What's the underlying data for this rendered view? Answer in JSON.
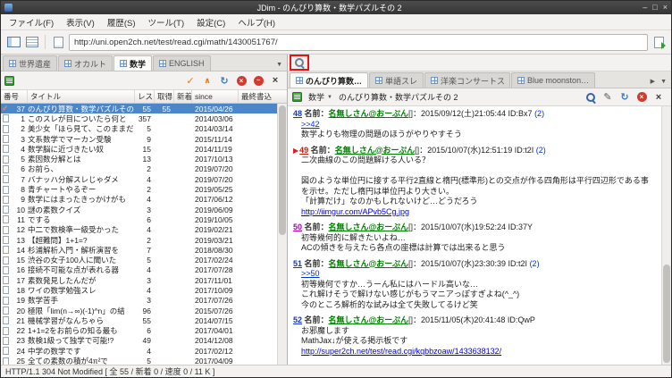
{
  "window": {
    "title": "JDim - のんびり算数・数学パズルその 2"
  },
  "menubar": {
    "items": [
      "ファイル(F)",
      "表示(V)",
      "履歴(S)",
      "ツール(T)",
      "設定(C)",
      "ヘルプ(H)"
    ]
  },
  "toolbar": {
    "url": "http://uni.open2ch.net/test/read.cgi/math/1430051767/"
  },
  "board_panel": {
    "tabs": [
      {
        "label": "世界遺産",
        "active": false
      },
      {
        "label": "オカルト",
        "active": false
      },
      {
        "label": "数学",
        "active": true
      },
      {
        "label": "ENGLISH",
        "active": false
      }
    ],
    "toolbar_icons": [
      "update-check",
      "update",
      "reload",
      "stop",
      "delete",
      "close"
    ],
    "columns": [
      "番号",
      "タイトル",
      "レス",
      "取得",
      "新着",
      "since",
      "最終書込"
    ],
    "rows": [
      {
        "no": "37",
        "title": "のんびり算数・数学パズルその 2",
        "res": "55",
        "got": "55",
        "new": "",
        "since": "2015/04/26",
        "last": "",
        "selected": true
      },
      {
        "no": "1",
        "title": "このスレが目についたら何と",
        "res": "357",
        "got": "",
        "new": "",
        "since": "2014/03/06",
        "last": "",
        "selected": false
      },
      {
        "no": "2",
        "title": "美少女「ほら見て、このままだ",
        "res": "5",
        "got": "",
        "new": "",
        "since": "2014/03/14",
        "last": "",
        "selected": false
      },
      {
        "no": "3",
        "title": "文系数学でマーカン受験",
        "res": "9",
        "got": "",
        "new": "",
        "since": "2015/11/14",
        "last": "",
        "selected": false
      },
      {
        "no": "4",
        "title": "数学脳に近づきたい奴",
        "res": "15",
        "got": "",
        "new": "",
        "since": "2014/11/19",
        "last": "",
        "selected": false
      },
      {
        "no": "5",
        "title": "素因数分解とは",
        "res": "13",
        "got": "",
        "new": "",
        "since": "2017/10/13",
        "last": "",
        "selected": false
      },
      {
        "no": "6",
        "title": "お前ら、",
        "res": "2",
        "got": "",
        "new": "",
        "since": "2019/07/20",
        "last": "",
        "selected": false
      },
      {
        "no": "7",
        "title": "バナッハ分解スレじゃダメ",
        "res": "4",
        "got": "",
        "new": "",
        "since": "2019/07/20",
        "last": "",
        "selected": false
      },
      {
        "no": "8",
        "title": "青チャートやるぞー",
        "res": "2",
        "got": "",
        "new": "",
        "since": "2019/05/25",
        "last": "",
        "selected": false
      },
      {
        "no": "9",
        "title": "数学にはまったきっかけがも",
        "res": "4",
        "got": "",
        "new": "",
        "since": "2017/06/12",
        "last": "",
        "selected": false
      },
      {
        "no": "10",
        "title": "謎の素数クイズ",
        "res": "3",
        "got": "",
        "new": "",
        "since": "2019/06/09",
        "last": "",
        "selected": false
      },
      {
        "no": "11",
        "title": "でする",
        "res": "6",
        "got": "",
        "new": "",
        "since": "2019/10/05",
        "last": "",
        "selected": false
      },
      {
        "no": "12",
        "title": "中二で数検準一級受かった",
        "res": "4",
        "got": "",
        "new": "",
        "since": "2019/02/21",
        "last": "",
        "selected": false
      },
      {
        "no": "13",
        "title": "【超難問】1+1=?",
        "res": "2",
        "got": "",
        "new": "",
        "since": "2019/03/21",
        "last": "",
        "selected": false
      },
      {
        "no": "14",
        "title": "杉浦解析入門・解析演習を",
        "res": "7",
        "got": "",
        "new": "",
        "since": "2018/08/30",
        "last": "",
        "selected": false
      },
      {
        "no": "15",
        "title": "渋谷の女子100人に聞いた",
        "res": "5",
        "got": "",
        "new": "",
        "since": "2017/02/24",
        "last": "",
        "selected": false
      },
      {
        "no": "16",
        "title": "接続不可能な点が表れる器",
        "res": "4",
        "got": "",
        "new": "",
        "since": "2017/07/28",
        "last": "",
        "selected": false
      },
      {
        "no": "17",
        "title": "素数発見したんだが",
        "res": "3",
        "got": "",
        "new": "",
        "since": "2017/11/01",
        "last": "",
        "selected": false
      },
      {
        "no": "18",
        "title": "ワイの数学勉強スレ",
        "res": "4",
        "got": "",
        "new": "",
        "since": "2017/10/09",
        "last": "",
        "selected": false
      },
      {
        "no": "19",
        "title": "数学苦手",
        "res": "3",
        "got": "",
        "new": "",
        "since": "2017/07/26",
        "last": "",
        "selected": false
      },
      {
        "no": "20",
        "title": "極限「lim(n→∞)(-1)^n」の結",
        "res": "96",
        "got": "",
        "new": "",
        "since": "2015/07/26",
        "last": "",
        "selected": false
      },
      {
        "no": "21",
        "title": "機械学習がなんちゃら",
        "res": "55",
        "got": "",
        "new": "",
        "since": "2014/07/15",
        "last": "",
        "selected": false
      },
      {
        "no": "22",
        "title": "1+1=2をお前らの知る最も",
        "res": "6",
        "got": "",
        "new": "",
        "since": "2017/04/01",
        "last": "",
        "selected": false
      },
      {
        "no": "23",
        "title": "数検1級って独学で可能!?",
        "res": "49",
        "got": "",
        "new": "",
        "since": "2014/12/08",
        "last": "",
        "selected": false
      },
      {
        "no": "24",
        "title": "中学の数学です",
        "res": "4",
        "got": "",
        "new": "",
        "since": "2017/02/12",
        "last": "",
        "selected": false
      },
      {
        "no": "25",
        "title": "全ての素数の積が4π²で",
        "res": "5",
        "got": "",
        "new": "",
        "since": "2017/04/09",
        "last": "",
        "selected": false
      }
    ]
  },
  "thread_panel": {
    "tabs": [
      {
        "label": "のんびり算数…",
        "active": true
      },
      {
        "label": "単語スレ",
        "active": false
      },
      {
        "label": "洋楽コンサートスレ",
        "active": false
      },
      {
        "label": "Blue moonston…",
        "active": false
      }
    ],
    "board_label": "数学",
    "title": "のんびり算数・数学パズルその 2",
    "toolbar_icons": [
      "search",
      "write",
      "reload",
      "stop",
      "close"
    ],
    "name_label": "名前：",
    "posts": [
      {
        "num": "48",
        "num_color": "#1536c9",
        "marker": "",
        "name": "名無しさん@おーぷん",
        "mail": "[]",
        "date": "：2015/09/12(土)21:05:44",
        "id": "ID:Bx7",
        "count": "(2)",
        "lines": [
          {
            "t": "anchor",
            "s": ">>42"
          },
          {
            "t": "text",
            "s": "数学よりも物理の問題のほうがやりやすそう"
          }
        ]
      },
      {
        "num": "49",
        "num_color": "#c21807",
        "marker": "▶",
        "name": "名無しさん@おーぷん",
        "mail": "[]",
        "date": "：2015/10/07(水)12:51:19",
        "id": "ID:t2I",
        "count": "(2)",
        "lines": [
          {
            "t": "text",
            "s": "二次曲線のこの問題解ける人いる？"
          },
          {
            "t": "blank",
            "s": ""
          },
          {
            "t": "text",
            "s": "図のような単位円に接する平行2直線と楕円(標準形)との交点が作る四角形は平行四辺形である事を示せ。ただし楕円は単位円より大きい。"
          },
          {
            "t": "text",
            "s": "「計算だけ」なのかもしれないけど…どうだろう"
          },
          {
            "t": "link",
            "s": "http://iimgur.com/APvb5Cg.jpg"
          }
        ]
      },
      {
        "num": "50",
        "num_color": "#b400b4",
        "marker": "",
        "name": "名無しさん@おーぷん",
        "mail": "[]",
        "date": "：2015/10/07(水)19:52:24",
        "id": "ID:37Y",
        "count": "",
        "lines": [
          {
            "t": "text",
            "s": "初等幾何的に解きたいよね…"
          },
          {
            "t": "text",
            "s": "ACの傾きを与えたら各点の座標は計算では出来ると思う"
          }
        ]
      },
      {
        "num": "51",
        "num_color": "#1536c9",
        "marker": "",
        "name": "名無しさん@おーぷん",
        "mail": "[]",
        "date": "：2015/10/07(水)23:30:39",
        "id": "ID:t2I",
        "count": "(2)",
        "lines": [
          {
            "t": "anchor",
            "s": ">>50"
          },
          {
            "t": "text",
            "s": "初等幾何ですか…うーん私にはハードル高いな…"
          },
          {
            "t": "text",
            "s": "これ解けそうで解けない感じがもうマニアっぽすぎよね(^_^)"
          },
          {
            "t": "text",
            "s": "今のところ解析的な試みは全て失敗してるけど笑"
          }
        ]
      },
      {
        "num": "52",
        "num_color": "#1536c9",
        "marker": "",
        "name": "名無しさん@おーぷん",
        "mail": "[]",
        "date": "：2015/11/05(木)20:41:48",
        "id": "ID:QwP",
        "count": "",
        "lines": [
          {
            "t": "text",
            "s": "お邪魔します"
          },
          {
            "t": "text",
            "s": "MathJax↓が使える掲示板です"
          },
          {
            "t": "link",
            "s": "http://super2ch.net/test/read.cgi/kqbbzoaw/1433638132/"
          }
        ]
      }
    ]
  },
  "statusbar": {
    "text": "HTTP/1.1 304 Not Modified [ 全 55 / 新着 0 / 速度 0 / 11 K ]"
  }
}
